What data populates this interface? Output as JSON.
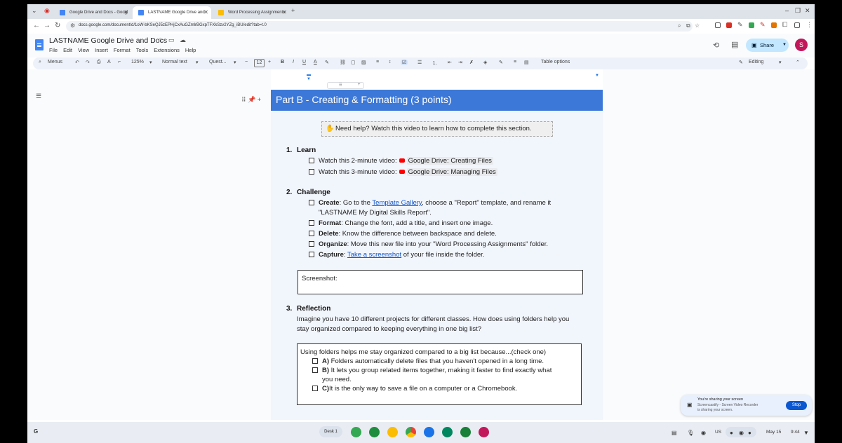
{
  "browser": {
    "tabs": [
      {
        "title": "Google Drive and Docs - Googl",
        "active": false,
        "color": "#4285f4"
      },
      {
        "title": "LASTNAME Google Drive and ",
        "active": true,
        "color": "#4285f4"
      },
      {
        "title": "Word Processing Assignments",
        "active": false,
        "color": "#fbbc04"
      }
    ],
    "url": "docs.google.com/document/d/1oW-bKSeQJ5zEPHjCxAuGZmlrBGxpTFXkSzv2YZg_iBU/edit?tab=t.0",
    "plus": "+",
    "window_controls": [
      "–",
      "❐",
      "✕"
    ]
  },
  "docs": {
    "title": "LASTNAME Google Drive and Docs",
    "menus": [
      "File",
      "Edit",
      "View",
      "Insert",
      "Format",
      "Tools",
      "Extensions",
      "Help"
    ],
    "share_label": "Share",
    "avatar_letter": "S"
  },
  "toolbar": {
    "menus_label": "Menus",
    "zoom": "125%",
    "style": "Normal text",
    "font": "Quest...",
    "font_size": "12",
    "bold": "B",
    "italic": "I",
    "underline": "U",
    "text_color": "A",
    "table_options": "Table options",
    "mode": "Editing"
  },
  "document": {
    "heading": "Part B - Creating & Formatting (3 points)",
    "help_text": "Need help? Watch this video to learn how to complete this section.",
    "learn": {
      "num": "1.",
      "title": "Learn",
      "items": [
        {
          "prefix": "Watch this 2-minute video:",
          "chip": "Google Drive: Creating Files"
        },
        {
          "prefix": "Watch this 3-minute video:",
          "chip": "Google Drive: Managing Files"
        }
      ]
    },
    "challenge": {
      "num": "2.",
      "title": "Challenge",
      "create": {
        "bold": "Create",
        "text1": ": Go to the ",
        "link": "Template Gallery",
        "text2": ", choose a \"Report\" template, and rename it",
        "line2": "\"LASTNAME My Digital Skills Report\"."
      },
      "format": {
        "bold": "Format",
        "text": ": Change the font, add a title, and insert one image."
      },
      "delete": {
        "bold": "Delete",
        "text": ": Know the difference between backspace and delete."
      },
      "organize": {
        "bold": "Organize",
        "text": ": Move this new file into your \"Word Processing Assignments\" folder."
      },
      "capture": {
        "bold": "Capture",
        "text1": ": ",
        "link": "Take a screenshot",
        "text2": " of your file inside the folder."
      }
    },
    "screenshot_label": "Screenshot:",
    "reflection": {
      "num": "3.",
      "title": "Reflection",
      "line1": "Imagine you have 10 different projects for different classes. How does using folders help you",
      "line2": "stay organized compared to keeping everything in one big list?",
      "box_intro": "Using folders helps me stay organized compared to a big list because...(check one)",
      "options": [
        {
          "letter": "A)",
          "text": "Folders automatically delete files that you haven't opened in a long time."
        },
        {
          "letter": "B)",
          "text": "It lets you group related items together, making it faster to find exactly what",
          "line2": "you need."
        },
        {
          "letter": "C)",
          "text": "It is the only way to save a file on a computer or a Chromebook."
        }
      ]
    }
  },
  "notification": {
    "title": "You're sharing your screen",
    "body": "Screencastify - Screen Video Recorder is sharing your screen.",
    "stop_label": "Stop"
  },
  "shelf": {
    "desk_label": "Desk 1",
    "launcher": "G",
    "locale": "US",
    "date": "May 15",
    "time": "9:44",
    "apps": [
      {
        "name": "phone-hub",
        "color": "#34a853"
      },
      {
        "name": "classroom",
        "color": "#1e8e3e"
      },
      {
        "name": "keep",
        "color": "#fbbc04"
      },
      {
        "name": "chrome",
        "color": "#ea4335"
      },
      {
        "name": "files",
        "color": "#1a73e8"
      },
      {
        "name": "play-store",
        "color": "#01875f"
      },
      {
        "name": "sheets",
        "color": "#188038"
      },
      {
        "name": "screencastify",
        "color": "#c2185b"
      }
    ]
  }
}
